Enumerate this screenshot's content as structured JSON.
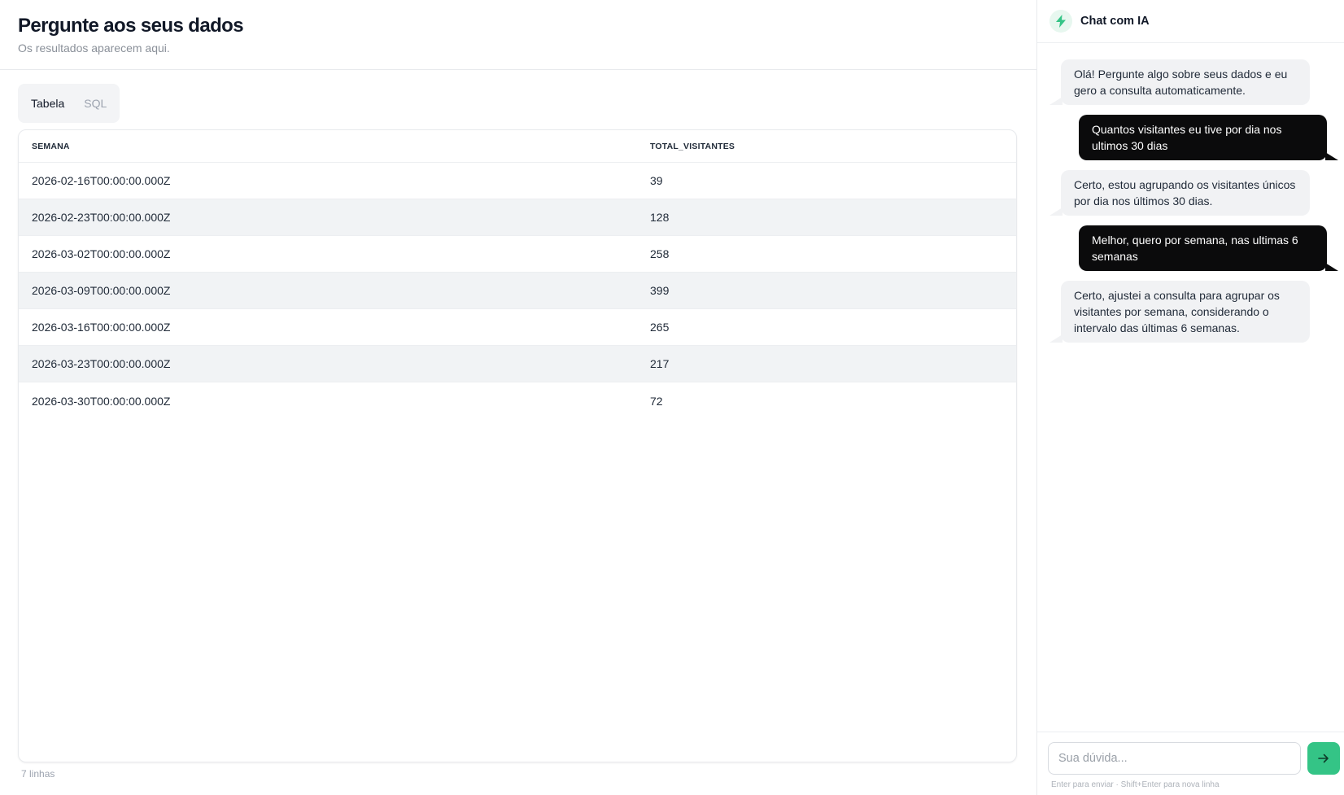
{
  "header": {
    "title": "Pergunte aos seus dados",
    "subtitle": "Os resultados aparecem aqui."
  },
  "tabs": [
    {
      "label": "Tabela",
      "active": true
    },
    {
      "label": "SQL",
      "active": false
    }
  ],
  "table": {
    "columns": [
      "SEMANA",
      "TOTAL_VISITANTES"
    ],
    "rows": [
      [
        "2026-02-16T00:00:00.000Z",
        "39"
      ],
      [
        "2026-02-23T00:00:00.000Z",
        "128"
      ],
      [
        "2026-03-02T00:00:00.000Z",
        "258"
      ],
      [
        "2026-03-09T00:00:00.000Z",
        "399"
      ],
      [
        "2026-03-16T00:00:00.000Z",
        "265"
      ],
      [
        "2026-03-23T00:00:00.000Z",
        "217"
      ],
      [
        "2026-03-30T00:00:00.000Z",
        "72"
      ]
    ],
    "row_count_label": "7 linhas"
  },
  "chat": {
    "title": "Chat com IA",
    "icon": "lightning-bolt-icon",
    "accent_color": "#34c486",
    "messages": [
      {
        "role": "ai",
        "text": "Olá! Pergunte algo sobre seus dados e eu gero a consulta automaticamente."
      },
      {
        "role": "user",
        "text": "Quantos visitantes eu tive por dia nos ultimos 30 dias"
      },
      {
        "role": "ai",
        "text": "Certo, estou agrupando os visitantes únicos por dia nos últimos 30 dias."
      },
      {
        "role": "user",
        "text": "Melhor, quero por semana, nas ultimas 6 semanas"
      },
      {
        "role": "ai",
        "text": "Certo, ajustei a consulta para agrupar os visitantes por semana, considerando o intervalo das últimas 6 semanas."
      }
    ],
    "input_placeholder": "Sua dúvida...",
    "input_value": "",
    "send_icon": "arrow-right-icon",
    "hint": "Enter para enviar · Shift+Enter para nova linha"
  }
}
